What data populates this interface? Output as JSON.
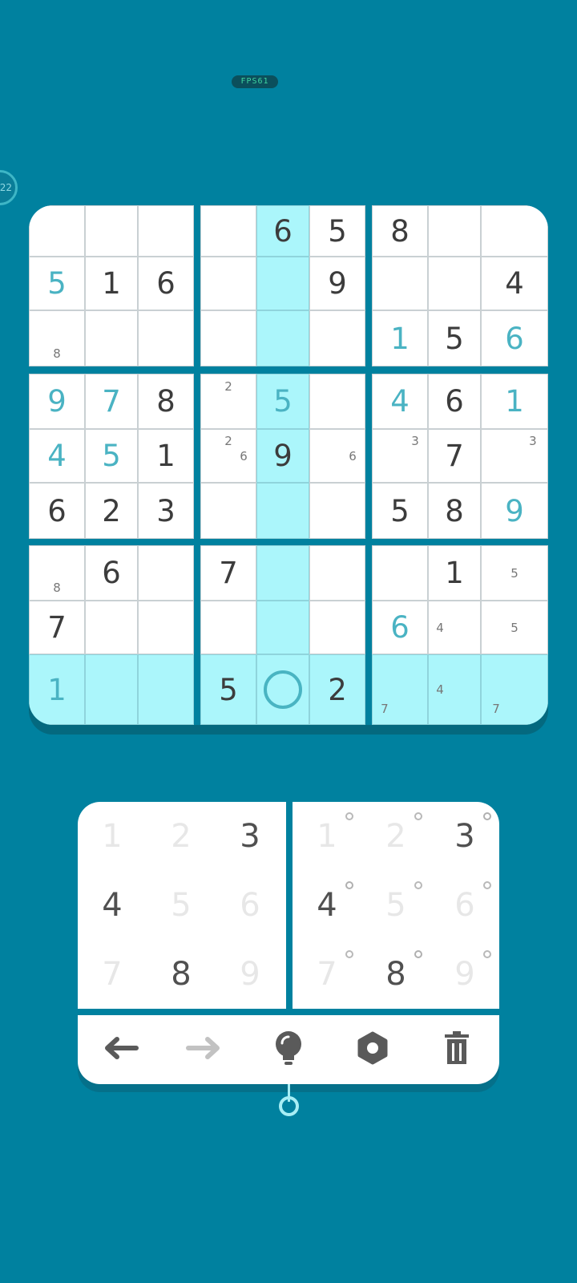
{
  "status": {
    "fps": "FPS61",
    "timer": "22"
  },
  "board": {
    "highlight_row": 8,
    "highlight_col": 4,
    "selected": [
      8,
      4
    ],
    "cells": [
      [
        0,
        0,
        0,
        0,
        "G6",
        "G5",
        "G8",
        0,
        0
      ],
      [
        "U5",
        "G1",
        "G6",
        0,
        0,
        "G9",
        0,
        0,
        "G4"
      ],
      [
        0,
        0,
        0,
        0,
        0,
        0,
        "U1",
        "G5",
        "U6"
      ],
      [
        "U9",
        "U7",
        "G8",
        0,
        "U5",
        0,
        "U4",
        "G6",
        "U1"
      ],
      [
        "U4",
        "U5",
        "G1",
        0,
        "G9",
        0,
        0,
        "G7",
        0
      ],
      [
        "G6",
        "G2",
        "G3",
        0,
        0,
        0,
        "G5",
        "G8",
        "U9"
      ],
      [
        0,
        "G6",
        0,
        "G7",
        0,
        0,
        0,
        "G1",
        0
      ],
      [
        "G7",
        0,
        0,
        0,
        0,
        0,
        "U6",
        0,
        0
      ],
      [
        "U1",
        0,
        0,
        "G5",
        0,
        "G2",
        0,
        0,
        0
      ]
    ],
    "notes": [
      {
        "r": 2,
        "c": 0,
        "n": "8",
        "pos": 8
      },
      {
        "r": 3,
        "c": 3,
        "n": "2",
        "pos": 2
      },
      {
        "r": 4,
        "c": 3,
        "n": "2",
        "pos": 2
      },
      {
        "r": 4,
        "c": 3,
        "n": "6",
        "pos": 6
      },
      {
        "r": 4,
        "c": 5,
        "n": "6",
        "pos": 6
      },
      {
        "r": 4,
        "c": 6,
        "n": "3",
        "pos": 3
      },
      {
        "r": 4,
        "c": 8,
        "n": "3",
        "pos": 3
      },
      {
        "r": 6,
        "c": 0,
        "n": "8",
        "pos": 8
      },
      {
        "r": 6,
        "c": 8,
        "n": "5",
        "pos": 5
      },
      {
        "r": 7,
        "c": 7,
        "n": "4",
        "pos": 4
      },
      {
        "r": 7,
        "c": 8,
        "n": "5",
        "pos": 5
      },
      {
        "r": 8,
        "c": 6,
        "n": "7",
        "pos": 7
      },
      {
        "r": 8,
        "c": 7,
        "n": "4",
        "pos": 4
      },
      {
        "r": 8,
        "c": 8,
        "n": "7",
        "pos": 7
      }
    ]
  },
  "pad": {
    "keys": [
      "1",
      "2",
      "3",
      "4",
      "5",
      "6",
      "7",
      "8",
      "9"
    ],
    "available": [
      false,
      false,
      true,
      true,
      false,
      false,
      false,
      true,
      false
    ]
  },
  "toolbar": {
    "tools": [
      {
        "name": "undo-icon",
        "color": "#5a5a5a"
      },
      {
        "name": "redo-icon",
        "color": "#c2c2c2"
      },
      {
        "name": "hint-bulb-icon",
        "color": "#5a5a5a"
      },
      {
        "name": "settings-gear-icon",
        "color": "#5a5a5a"
      },
      {
        "name": "trash-icon",
        "color": "#5a5a5a"
      }
    ]
  },
  "colors": {
    "background": "#00819f",
    "highlight": "#abf6fb",
    "given_digit": "#3c3c3c",
    "user_digit": "#4ab3c3"
  }
}
